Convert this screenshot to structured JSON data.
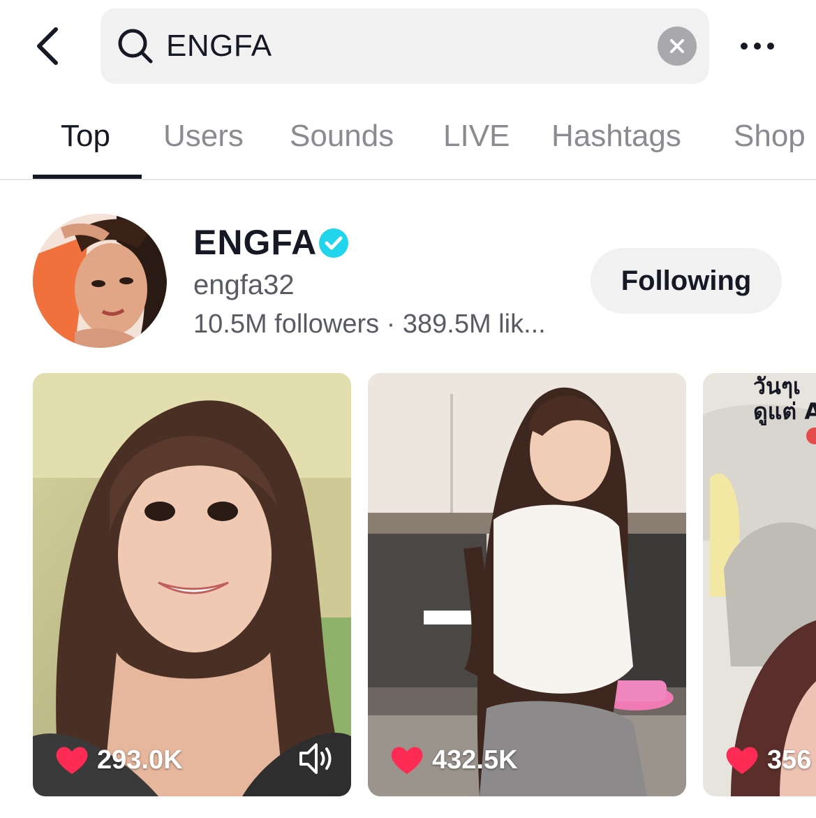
{
  "search": {
    "query": "ENGFA"
  },
  "icons": {
    "back": "chevron-left-icon",
    "search": "search-icon",
    "clear": "clear-icon",
    "more": "more-icon",
    "verified": "verified-badge-icon",
    "heart": "heart-icon",
    "sound": "speaker-icon"
  },
  "tabs": [
    {
      "label": "Top",
      "active": true
    },
    {
      "label": "Users",
      "active": false
    },
    {
      "label": "Sounds",
      "active": false
    },
    {
      "label": "LIVE",
      "active": false
    },
    {
      "label": "Hashtags",
      "active": false
    },
    {
      "label": "Shop",
      "active": false
    }
  ],
  "profile": {
    "name": "ENGFA",
    "handle": "engfa32",
    "stats": "10.5M followers · 389.5M lik...",
    "follow_label": "Following"
  },
  "videos": [
    {
      "likes": "293.0K",
      "has_sound_icon": true
    },
    {
      "likes": "432.5K",
      "has_sound_icon": false
    },
    {
      "likes": "356",
      "overlay_text_line1": "วันๆเ",
      "overlay_text_line2": "ดูแต่ A",
      "has_sound_icon": false
    }
  ],
  "colors": {
    "text_primary": "#161823",
    "text_secondary": "#8a8b91",
    "heart": "#fe2c55",
    "verified": "#20d5ec",
    "pill_bg": "#f1f1f2"
  }
}
